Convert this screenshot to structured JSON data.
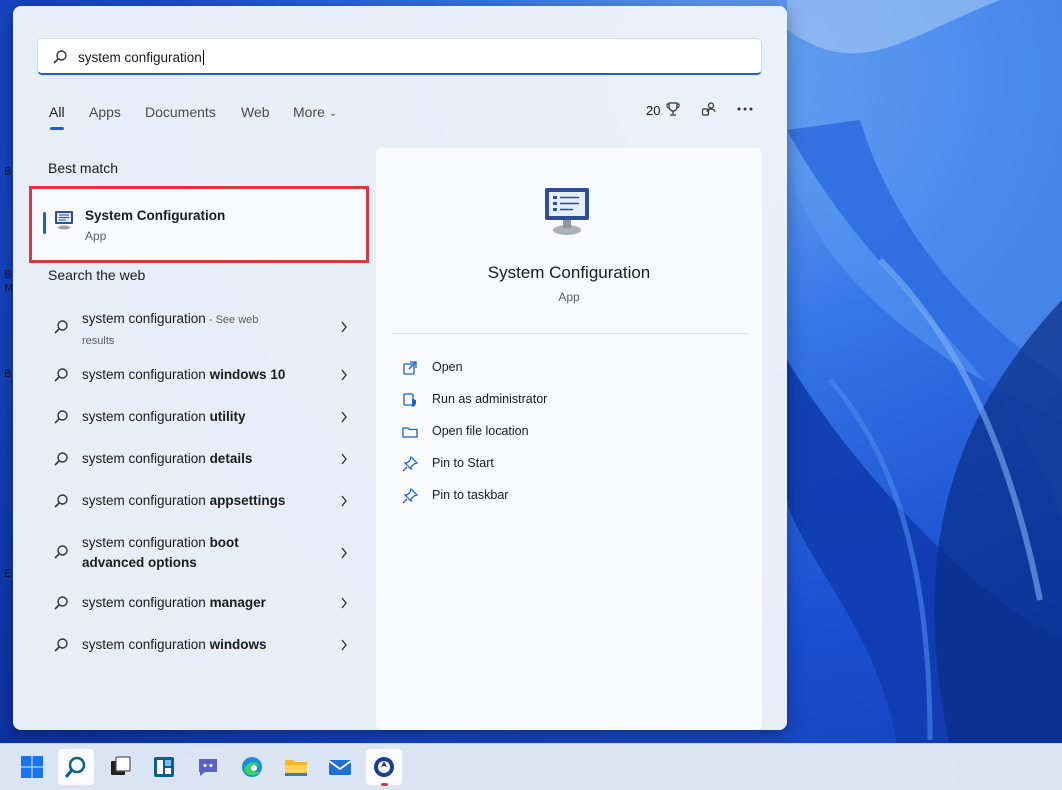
{
  "search": {
    "query": "system configuration"
  },
  "tabs": [
    {
      "label": "All",
      "active": true
    },
    {
      "label": "Apps"
    },
    {
      "label": "Documents"
    },
    {
      "label": "Web"
    },
    {
      "label": "More"
    }
  ],
  "header": {
    "points": "20"
  },
  "best_match": {
    "section_title": "Best match",
    "name": "System Configuration",
    "type": "App"
  },
  "web": {
    "section_title": "Search the web",
    "results": [
      {
        "prefix": "system configuration",
        "bold": "",
        "suffix": " - See web",
        "sub": "results"
      },
      {
        "prefix": "system configuration ",
        "bold": "windows 10"
      },
      {
        "prefix": "system configuration ",
        "bold": "utility"
      },
      {
        "prefix": "system configuration ",
        "bold": "details"
      },
      {
        "prefix": "system configuration ",
        "bold": "appsettings"
      },
      {
        "prefix": "system configuration ",
        "bold": "boot",
        "line2": "advanced options"
      },
      {
        "prefix": "system configuration ",
        "bold": "manager"
      },
      {
        "prefix": "system configuration ",
        "bold": "windows"
      }
    ]
  },
  "detail": {
    "name": "System Configuration",
    "type": "App",
    "actions": [
      {
        "label": "Open",
        "icon": "open-external-icon"
      },
      {
        "label": "Run as administrator",
        "icon": "shield-icon"
      },
      {
        "label": "Open file location",
        "icon": "folder-icon"
      },
      {
        "label": "Pin to Start",
        "icon": "pin-icon"
      },
      {
        "label": "Pin to taskbar",
        "icon": "pin-icon"
      }
    ]
  },
  "desktop_letters": [
    "B",
    "B",
    "M",
    "B",
    "E"
  ],
  "taskbar": {
    "items": [
      "start-icon",
      "search-icon",
      "task-view-icon",
      "widgets-icon",
      "chat-icon",
      "edge-icon",
      "file-explorer-icon",
      "mail-icon",
      "active-app-icon"
    ]
  },
  "colors": {
    "accent": "#1f5fc8",
    "highlight_border": "#d9393f"
  }
}
